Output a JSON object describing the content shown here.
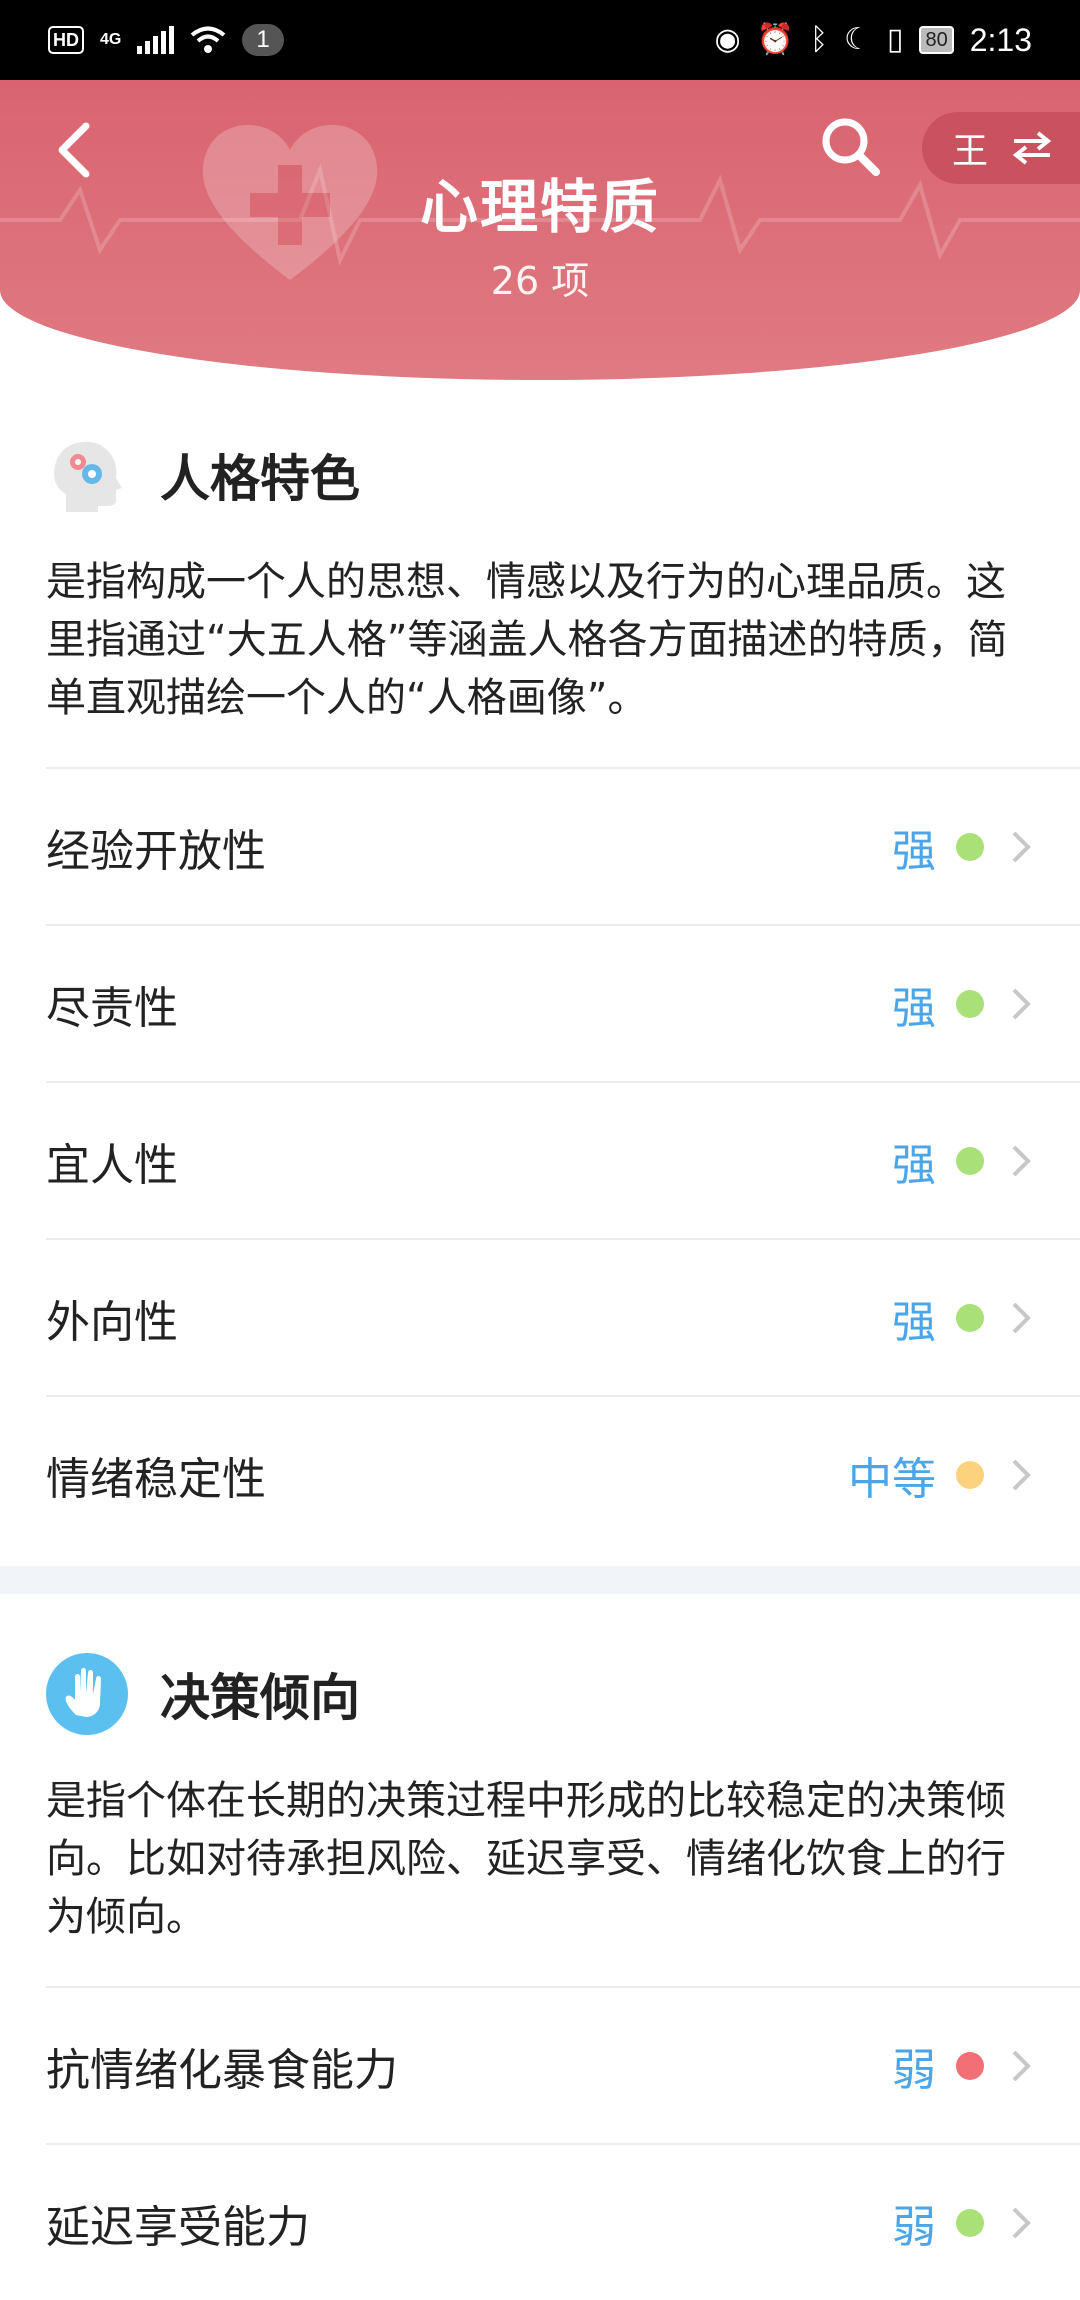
{
  "status_bar": {
    "left": {
      "hd": "HD",
      "network": "4G",
      "notification_count": "1"
    },
    "right": {
      "battery": "80",
      "time": "2:13"
    },
    "icons": [
      "eye-icon",
      "alarm-icon",
      "bluetooth-icon",
      "moon-icon",
      "vibrate-icon"
    ]
  },
  "header": {
    "title": "心理特质",
    "subtitle": "26 项",
    "user_switch_label": "王",
    "accent_color": "#d96470"
  },
  "sections": [
    {
      "title": "人格特色",
      "icon": "head-gears-icon",
      "description": "是指构成一个人的思想、情感以及行为的心理品质。这里指通过“大五人格”等涵盖人格各方面描述的特质，简单直观描绘一个人的“人格画像”。",
      "items": [
        {
          "label": "经验开放性",
          "level": "强",
          "dot_color": "#a9e178"
        },
        {
          "label": "尽责性",
          "level": "强",
          "dot_color": "#a9e178"
        },
        {
          "label": "宜人性",
          "level": "强",
          "dot_color": "#a9e178"
        },
        {
          "label": "外向性",
          "level": "强",
          "dot_color": "#a9e178"
        },
        {
          "label": "情绪稳定性",
          "level": "中等",
          "dot_color": "#fcd27e"
        }
      ]
    },
    {
      "title": "决策倾向",
      "icon": "hand-icon",
      "description": "是指个体在长期的决策过程中形成的比较稳定的决策倾向。比如对待承担风险、延迟享受、情绪化饮食上的行为倾向。",
      "items": [
        {
          "label": "抗情绪化暴食能力",
          "level": "弱",
          "dot_color": "#f26f76"
        },
        {
          "label": "延迟享受能力",
          "level": "弱",
          "dot_color": "#a9e178"
        }
      ]
    }
  ],
  "colors": {
    "level_text": "#4aa6e8",
    "strong": "#a9e178",
    "medium": "#fcd27e",
    "weak": "#f26f76"
  }
}
